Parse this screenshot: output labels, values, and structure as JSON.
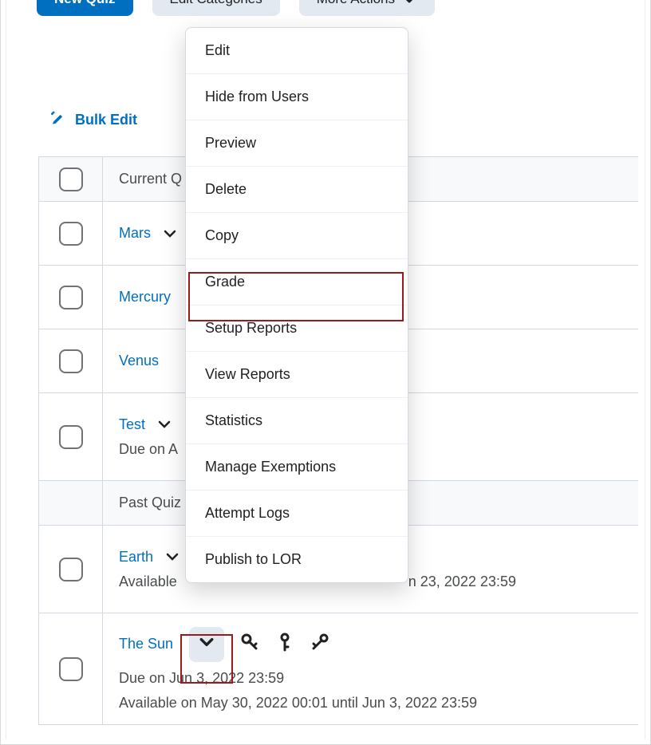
{
  "toolbar": {
    "new_quiz": "New Quiz",
    "edit_categories": "Edit Categories",
    "more_actions": "More Actions"
  },
  "bulk_edit": "Bulk Edit",
  "section_current": "Current Q",
  "section_past": "Past Quiz",
  "quizzes": {
    "mars": {
      "name": "Mars"
    },
    "mercury": {
      "name": "Mercury"
    },
    "venus": {
      "name": "Venus"
    },
    "test": {
      "name": "Test",
      "due": "Due on A"
    },
    "earth": {
      "name": "Earth",
      "avail_prefix": "Available",
      "avail_suffix": "n 23, 2022 23:59"
    },
    "sun": {
      "name": "The Sun",
      "due": "Due on Jun 3, 2022 23:59",
      "avail": "Available on May 30, 2022 00:01 until Jun 3, 2022 23:59"
    }
  },
  "menu": {
    "edit": "Edit",
    "hide": "Hide from Users",
    "preview": "Preview",
    "delete": "Delete",
    "copy": "Copy",
    "grade": "Grade",
    "setup_reports": "Setup Reports",
    "view_reports": "View Reports",
    "statistics": "Statistics",
    "manage_exemptions": "Manage Exemptions",
    "attempt_logs": "Attempt Logs",
    "publish_lor": "Publish to LOR"
  }
}
